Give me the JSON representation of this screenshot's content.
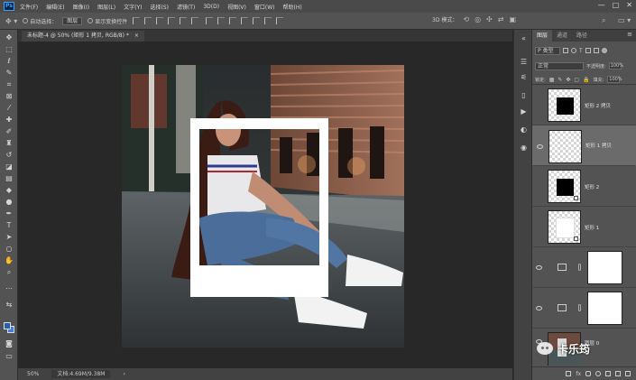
{
  "app": {
    "logo": "Ps",
    "menu": [
      "文件(F)",
      "编辑(E)",
      "图像(I)",
      "图层(L)",
      "文字(Y)",
      "选择(S)",
      "滤镜(T)",
      "3D(D)",
      "视图(V)",
      "窗口(W)",
      "帮助(H)"
    ],
    "window_controls": [
      "—",
      "□",
      "✕"
    ]
  },
  "options_bar": {
    "move_icon": "move-tool-icon",
    "auto_select_label": "自动选择：",
    "auto_select_target": "图层",
    "show_transform_label": "显示变换控件",
    "mode_3d_label": "3D 模式："
  },
  "document": {
    "tab_title": "未标题-4 @ 50% (矩形 1 拷贝, RGB/8) *",
    "tab_close": "×"
  },
  "status": {
    "zoom": "50%",
    "doc_size": "文档:4.69M/9.38M",
    "arrow": "›"
  },
  "toolbar": {
    "tools": [
      "move",
      "marquee",
      "lasso",
      "quick-select",
      "crop",
      "eyedropper",
      "healing",
      "brush",
      "clone-stamp",
      "history-brush",
      "eraser",
      "gradient",
      "blur",
      "dodge",
      "pen",
      "type",
      "path-select",
      "shape",
      "hand",
      "zoom",
      "more"
    ]
  },
  "layers_panel": {
    "tabs": [
      "图层",
      "通道",
      "路径"
    ],
    "active_tab": 0,
    "filter_kind": "P 类型",
    "blend_mode": "正常",
    "opacity_label": "不透明度:",
    "opacity": "100%",
    "lock_label": "锁定:",
    "fill_label": "填充:",
    "fill": "100%",
    "layers": [
      {
        "name": "矩形 2 拷贝",
        "visible": false,
        "kind": "black"
      },
      {
        "name": "矩形 1 拷贝",
        "visible": true,
        "kind": "empty",
        "selected": true
      },
      {
        "name": "矩形 2",
        "visible": false,
        "kind": "black"
      },
      {
        "name": "矩形 1",
        "visible": false,
        "kind": "white"
      },
      {
        "name": "",
        "visible": true,
        "kind": "adjust"
      },
      {
        "name": "",
        "visible": true,
        "kind": "adjust"
      },
      {
        "name": "图层 0",
        "visible": true,
        "kind": "photo"
      }
    ]
  },
  "watermark": {
    "text": "卡乐筠"
  },
  "colors": {
    "accent": "#31a8ff",
    "foreground_swatch": "#2b5eb0",
    "background_swatch": "#3f7de6"
  }
}
